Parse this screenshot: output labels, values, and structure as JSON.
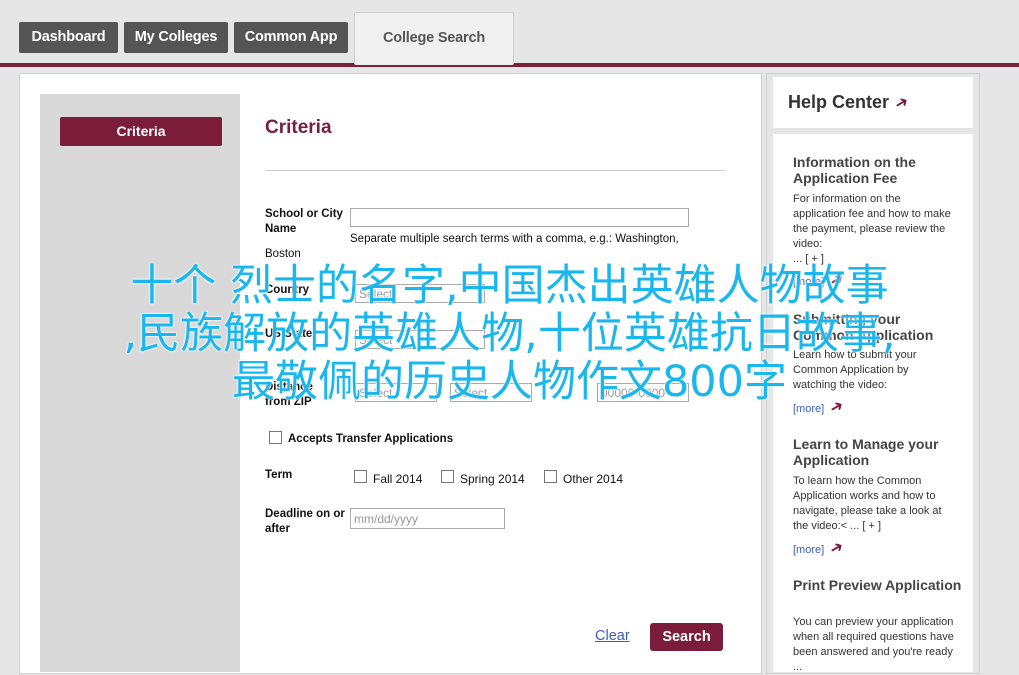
{
  "tabs": [
    {
      "label": "Dashboard"
    },
    {
      "label": "My Colleges"
    },
    {
      "label": "Common App"
    },
    {
      "label": "College Search"
    }
  ],
  "sidebar": {
    "criteria_button": "Criteria"
  },
  "form": {
    "title": "Criteria",
    "school_label": "School or City Name",
    "school_value": "Boston",
    "school_hint": "Separate multiple search terms with a comma, e.g.: Washington,",
    "country_label": "Country",
    "country_select": "Select",
    "us_state_label": "US State",
    "us_state_select": "Select",
    "distance_label": "Distance from ZIP",
    "distance_select": "Select",
    "zip_placeholder": "00000-0000",
    "transfer_label": "Accepts Transfer Applications",
    "term_label": "Term",
    "terms": [
      "Fall 2014",
      "Spring 2014",
      "Other 2014"
    ],
    "deadline_label": "Deadline on or after",
    "deadline_placeholder": "mm/dd/yyyy",
    "clear_label": "Clear",
    "search_label": "Search"
  },
  "help": {
    "title": "Help Center",
    "sections": [
      {
        "title": "Information on the Application Fee",
        "text": "For information on the application fee and how to make the payment, please review the video:",
        "extra": "... [ + ]",
        "more": "[more]"
      },
      {
        "title": "Submitting your Common Application",
        "text": "Learn how to submit your Common Application by watching the video:",
        "extra": "",
        "more": "[more]"
      },
      {
        "title": "Learn to Manage your Application",
        "text": "To learn how the Common Application works and how to navigate, please take a look at the video:< ... [ + ]",
        "extra": "",
        "more": "[more]"
      },
      {
        "title": "Print Preview Application",
        "text": "You can preview your application when all required questions have been answered and you're ready ...",
        "extra": "",
        "more": ""
      }
    ]
  },
  "overlay": {
    "line1": "十个 烈士的名字,中国杰出英雄人物故事",
    "line2": ",民族解放的英雄人物,十位英雄抗日故事,",
    "line3": "最敬佩的历史人物作文800字"
  },
  "colors": {
    "accent": "#7b1d3a",
    "link": "#3a5db8",
    "overlay": "#19b7ee"
  }
}
